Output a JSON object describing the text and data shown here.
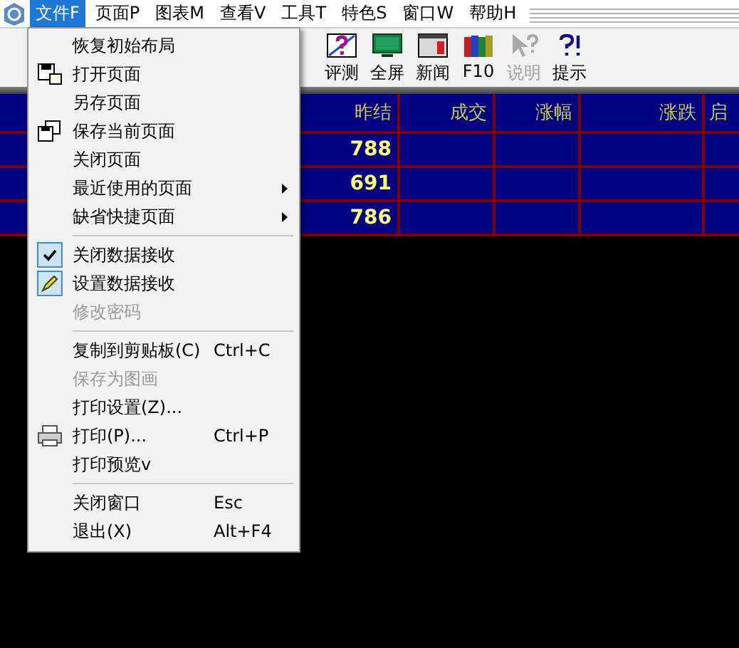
{
  "menu_bar": {
    "items": [
      {
        "label": "文件F",
        "selected": true
      },
      {
        "label": "页面P",
        "selected": false
      },
      {
        "label": "图表M",
        "selected": false
      },
      {
        "label": "查看V",
        "selected": false
      },
      {
        "label": "工具T",
        "selected": false
      },
      {
        "label": "特色S",
        "selected": false
      },
      {
        "label": "窗口W",
        "selected": false
      },
      {
        "label": "帮助H",
        "selected": false
      }
    ]
  },
  "toolbar": {
    "items": [
      {
        "label": "评测",
        "disabled": false
      },
      {
        "label": "全屏",
        "disabled": false
      },
      {
        "label": "新闻",
        "disabled": false
      },
      {
        "label": "F10",
        "disabled": false
      },
      {
        "label": "说明",
        "disabled": true
      },
      {
        "label": "提示",
        "disabled": false
      }
    ]
  },
  "table": {
    "columns": [
      "昨结",
      "成交",
      "涨幅",
      "涨跌",
      "启"
    ],
    "rows": [
      [
        "788",
        "",
        "",
        "",
        ""
      ],
      [
        "691",
        "",
        "",
        "",
        ""
      ],
      [
        "786",
        "",
        "",
        "",
        ""
      ]
    ]
  },
  "file_menu": {
    "items": [
      {
        "kind": "item",
        "label": "恢复初始布局",
        "disabled": false
      },
      {
        "kind": "item",
        "label": "打开页面",
        "disabled": false
      },
      {
        "kind": "item",
        "label": "另存页面",
        "disabled": false
      },
      {
        "kind": "item",
        "label": "保存当前页面",
        "disabled": false
      },
      {
        "kind": "item",
        "label": "关闭页面",
        "disabled": false
      },
      {
        "kind": "item",
        "label": "最近使用的页面",
        "submenu": true,
        "disabled": false
      },
      {
        "kind": "item",
        "label": "缺省快捷页面",
        "submenu": true,
        "disabled": false
      },
      {
        "kind": "separator"
      },
      {
        "kind": "item",
        "label": "关闭数据接收",
        "checked": true,
        "disabled": false
      },
      {
        "kind": "item",
        "label": "设置数据接收",
        "disabled": false
      },
      {
        "kind": "item",
        "label": "修改密码",
        "disabled": true
      },
      {
        "kind": "separator"
      },
      {
        "kind": "item",
        "label": "复制到剪贴板(C)",
        "shortcut": "Ctrl+C",
        "disabled": false
      },
      {
        "kind": "item",
        "label": "保存为图画",
        "disabled": true
      },
      {
        "kind": "item",
        "label": "打印设置(Z)...",
        "disabled": false
      },
      {
        "kind": "item",
        "label": "打印(P)...",
        "shortcut": "Ctrl+P",
        "disabled": false
      },
      {
        "kind": "item",
        "label": "打印预览v",
        "disabled": false
      },
      {
        "kind": "separator"
      },
      {
        "kind": "item",
        "label": "关闭窗口",
        "shortcut": "Esc",
        "disabled": false
      },
      {
        "kind": "item",
        "label": "退出(X)",
        "shortcut": "Alt+F4",
        "disabled": false
      }
    ]
  }
}
